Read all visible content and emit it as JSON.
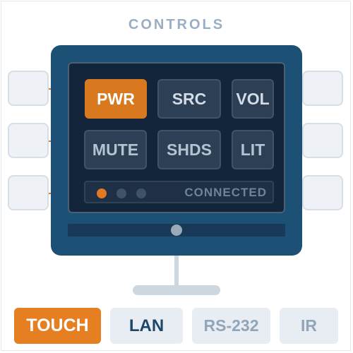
{
  "title": "CONTROLS",
  "panel": {
    "buttons": [
      {
        "label": "PWR",
        "lit": true
      },
      {
        "label": "SRC",
        "lit": false
      },
      {
        "label": "VOL",
        "lit": false
      },
      {
        "label": "MUTE",
        "lit": false
      },
      {
        "label": "SHDS",
        "lit": false
      },
      {
        "label": "LIT",
        "lit": false
      }
    ],
    "status": {
      "text": "CONNECTED",
      "indicators": [
        "on",
        "off",
        "off"
      ]
    }
  },
  "tabs": [
    {
      "label": "TOUCH",
      "state": "active"
    },
    {
      "label": "LAN",
      "state": "primary"
    },
    {
      "label": "RS-232",
      "state": "muted"
    },
    {
      "label": "IR",
      "state": "muted"
    }
  ],
  "colors": {
    "accent": "#e57f22",
    "device": "#1d5075",
    "screen": "#13253b",
    "title": "#9aaec2"
  }
}
